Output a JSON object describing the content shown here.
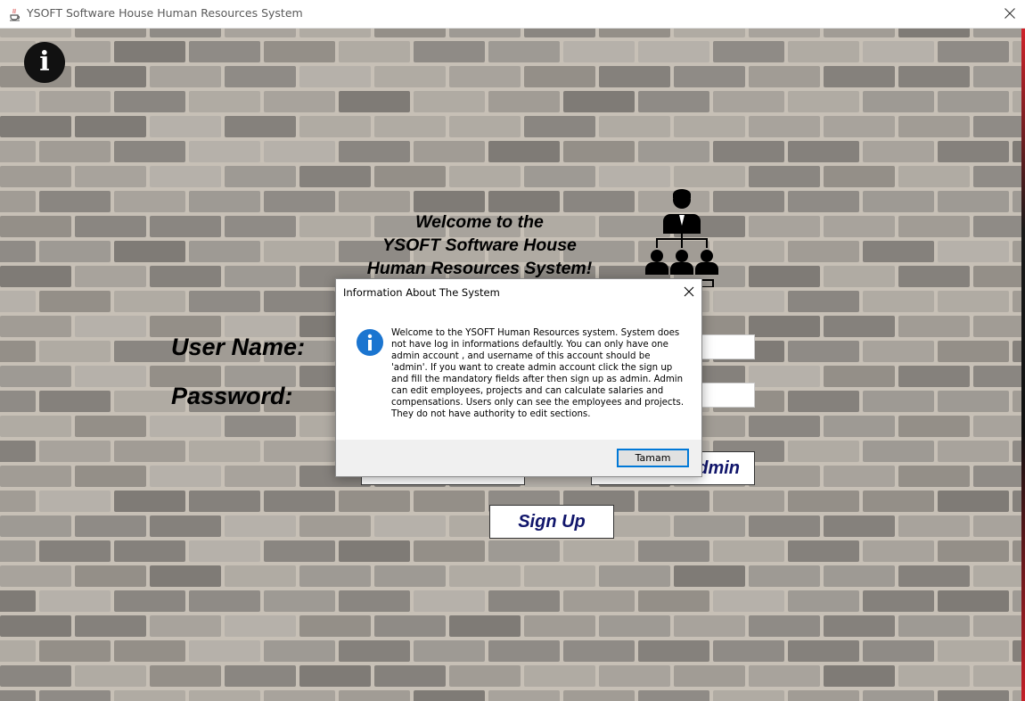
{
  "window": {
    "title": "YSOFT Software House Human Resources System",
    "app_icon": "java-cup-icon",
    "close_icon": "close-icon"
  },
  "main": {
    "info_icon_glyph": "i",
    "welcome_lines": [
      "Welcome to the",
      "YSOFT Software House",
      "Human Resources System!"
    ],
    "org_icon": "organization-chart-icon",
    "username_label": "User Name:",
    "password_label": "Password:",
    "username_value": "",
    "password_value": "",
    "admin_button_label": "Admin",
    "signup_button_label": "Sign Up"
  },
  "dialog": {
    "title": "Information About The System",
    "icon": "information-icon",
    "message": "Welcome to the YSOFT Human Resources system. System does not have log in informations defaultly. You can only have one admin account , and username of this account should be 'admin'. If you want to create admin account click the sign up and fill the mandatory fields after then sign up as admin. Admin can edit employees, projects and can calculate salaries and compensations. Users only can see the employees and projects. They do not have authority to edit sections.",
    "ok_label": "Tamam"
  },
  "colors": {
    "button_text": "#10156b",
    "dialog_accent": "#0078d7",
    "wall_mortar": "#c7c0b6"
  }
}
